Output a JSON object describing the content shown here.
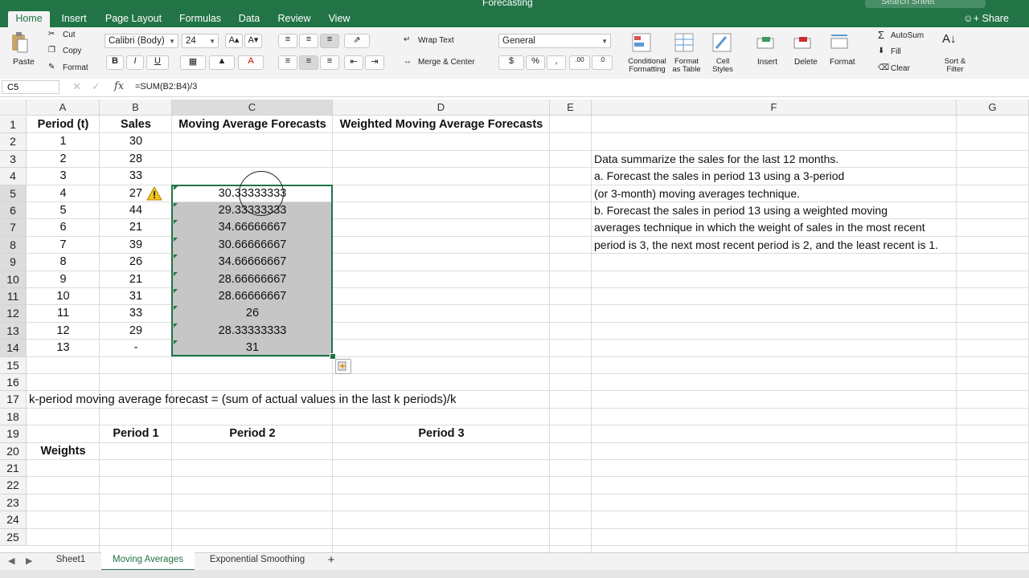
{
  "app": {
    "doc_title": "Forecasting",
    "search_placeholder": "Search Sheet",
    "share_label": "Share",
    "brand_color": "#227446"
  },
  "ribbon_tabs": [
    {
      "label": "Home",
      "active": true
    },
    {
      "label": "Insert"
    },
    {
      "label": "Page Layout"
    },
    {
      "label": "Formulas"
    },
    {
      "label": "Data"
    },
    {
      "label": "Review"
    },
    {
      "label": "View"
    }
  ],
  "ribbon": {
    "paste": "Paste",
    "cut": "Cut",
    "copy": "Copy",
    "format": "Format",
    "font_name": "Calibri (Body)",
    "font_size": "24",
    "bold": "B",
    "italic": "I",
    "underline": "U",
    "wrap_text": "Wrap Text",
    "merge_center": "Merge & Center",
    "number_format": "General",
    "currency": "$",
    "percent": "%",
    "comma": ",",
    "conditional_formatting": "Conditional\nFormatting",
    "format_as_table": "Format\nas Table",
    "cell_styles": "Cell\nStyles",
    "insert": "Insert",
    "delete": "Delete",
    "format_cells": "Format",
    "autosum": "AutoSum",
    "fill": "Fill",
    "clear": "Clear",
    "sort_filter": "Sort &\nFilter"
  },
  "formula_bar": {
    "name_box": "C5",
    "fx": "fx",
    "formula": "=SUM(B2:B4)/3"
  },
  "columns": [
    "A",
    "B",
    "C",
    "D",
    "E",
    "F",
    "G"
  ],
  "rows": [
    "1",
    "2",
    "3",
    "4",
    "5",
    "6",
    "7",
    "8",
    "9",
    "10",
    "11",
    "12",
    "13",
    "14",
    "15",
    "16",
    "17",
    "18",
    "19",
    "20",
    "21",
    "22",
    "23",
    "24",
    "25"
  ],
  "cells": {
    "A1": "Period (t)",
    "B1": "Sales",
    "C1": "Moving Average Forecasts",
    "D1": "Weighted Moving Average Forecasts",
    "A2": "1",
    "B2": "30",
    "A3": "2",
    "B3": "28",
    "A4": "3",
    "B4": "33",
    "A5": "4",
    "B5": "27",
    "C5": "30.33333333",
    "A6": "5",
    "B6": "44",
    "C6": "29.33333333",
    "A7": "6",
    "B7": "21",
    "C7": "34.66666667",
    "A8": "7",
    "B8": "39",
    "C8": "30.66666667",
    "A9": "8",
    "B9": "26",
    "C9": "34.66666667",
    "A10": "9",
    "B10": "21",
    "C10": "28.66666667",
    "A11": "10",
    "B11": "31",
    "C11": "28.66666667",
    "A12": "11",
    "B12": "33",
    "C12": "26",
    "A13": "12",
    "B13": "29",
    "C13": "28.33333333",
    "A14": "13",
    "B14": "-",
    "C14": "31",
    "A17": "k-period moving average forecast = (sum of actual values in the last k periods)/k",
    "B19": "Period 1",
    "C19": "Period 2",
    "D19": "Period 3",
    "A20": "Weights",
    "F3": "Data summarize the sales for the last 12 months.",
    "F4": "a.  Forecast the sales in period 13 using a 3-period",
    "F5": "(or 3-month) moving averages technique.",
    "F6": "b. Forecast the sales in period 13 using a weighted moving",
    "F7": "averages technique in which the weight of sales in the most recent",
    "F8": " period is 3, the next most recent period is 2, and the least recent is 1."
  },
  "sheet_tabs": [
    {
      "label": "Sheet1"
    },
    {
      "label": "Moving Averages",
      "active": true
    },
    {
      "label": "Exponential Smoothing"
    }
  ],
  "add_sheet": "+"
}
